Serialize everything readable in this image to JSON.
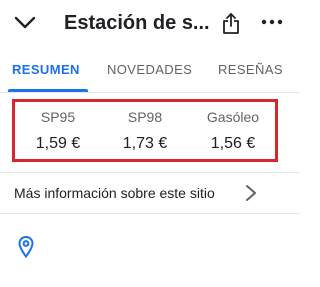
{
  "header": {
    "title": "Estación de s...",
    "icons": {
      "back": "chevron-down-icon",
      "share": "share-icon",
      "more": "more-horizontal-icon"
    }
  },
  "tabs": [
    {
      "label": "RESUMEN",
      "active": true
    },
    {
      "label": "NOVEDADES",
      "active": false
    },
    {
      "label": "RESEÑAS",
      "active": false
    }
  ],
  "prices": [
    {
      "label": "SP95",
      "value": "1,59 €"
    },
    {
      "label": "SP98",
      "value": "1,73 €"
    },
    {
      "label": "Gasóleo",
      "value": "1,56 €"
    }
  ],
  "info_row": {
    "label": "Más información sobre este sitio",
    "icon": "chevron-right-icon"
  },
  "location": {
    "icon": "location-pin-icon"
  },
  "colors": {
    "accent": "#1a73e8",
    "highlight_border": "#d9262c",
    "text_primary": "#202124",
    "text_secondary": "#5f6368"
  }
}
